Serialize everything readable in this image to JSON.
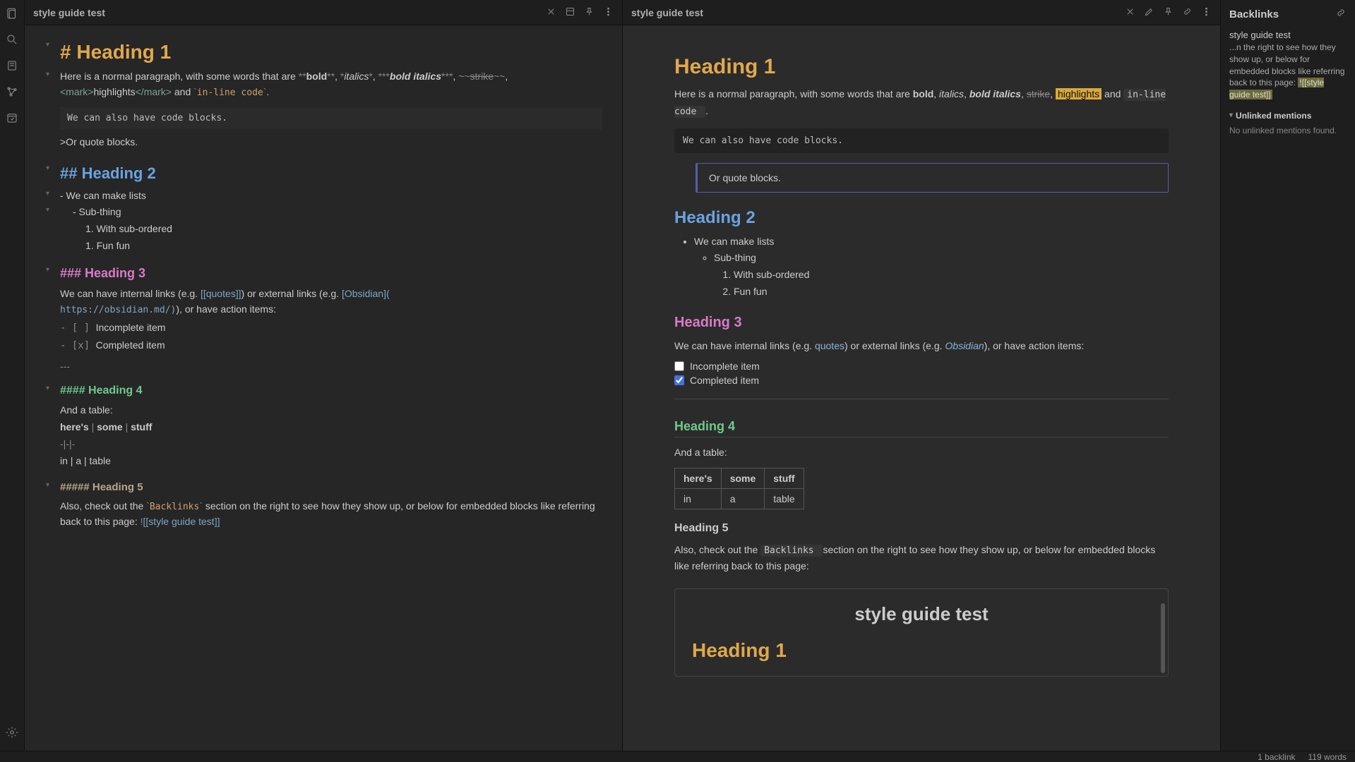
{
  "ribbon": {
    "icons": [
      "files",
      "search",
      "note",
      "graph",
      "daily",
      "settings"
    ]
  },
  "leftPane": {
    "title": "style guide test",
    "h1": "# Heading 1",
    "para1_a": "Here is a normal paragraph, with some words that are ",
    "bold_mk": "**",
    "bold": "bold",
    "ital_mk": "*",
    "ital": "italics",
    "bi_mk": "***",
    "bi": "bold italics",
    "strike_mk": "~~",
    "strike": "strike",
    "mark_open": "<mark>",
    "highlights": "highlights",
    "mark_close": "</mark>",
    "and": " and ",
    "tick": "`",
    "inline_code": "in-line code",
    "period": ".",
    "codeblk": "We can also have code blocks.",
    "quote": ">Or quote blocks.",
    "h2": "## Heading 2",
    "li1": "- We can make lists",
    "li2": "- Sub-thing",
    "li3": "1. With sub-ordered",
    "li4": "1. Fun fun",
    "h3": "### Heading 3",
    "p3_a": "We can have internal links (e.g. ",
    "lnk_q": "[[quotes]]",
    "p3_b": ") or external links (e.g. ",
    "lnk_o": "[Obsidian](",
    "lnk_u": "https://obsidian.md/)",
    "p3_c": "), or have action items:",
    "chk1_mk": "- [ ] ",
    "chk1": "Incomplete item",
    "chk2_mk": "- [x] ",
    "chk2": "Completed item",
    "hr": "---",
    "h4": "#### Heading 4",
    "tbl_intro": "And a table:",
    "tbl_h": "here's | some | stuff",
    "tbl_sep": "-|-|-",
    "tbl_r": "in | a | table",
    "thb": [
      "here's",
      "some",
      "stuff"
    ],
    "h5": "##### Heading 5",
    "p5_a": "Also, check out the ",
    "bl": "Backlinks",
    "p5_b": " section on the right to see how they show up, or below for embedded blocks like referring back to this page: ",
    "embed_mk": "!",
    "embed": "[[style guide test]]"
  },
  "rightPane": {
    "title": "style guide test",
    "h1": "Heading 1",
    "p1_a": "Here is a normal paragraph, with some words that are ",
    "bold": "bold",
    "ital": "italics",
    "bi": "bold italics",
    "strike": "strike",
    "hl": "highlights",
    "and": " and ",
    "inline": "in-line code ",
    "period": ".",
    "code": "We can also have code blocks.",
    "quote": "Or quote blocks.",
    "h2": "Heading 2",
    "li1": "We can make lists",
    "li2": "Sub-thing",
    "li3": "With sub-ordered",
    "li4": "Fun fun",
    "h3": "Heading 3",
    "p3_a": "We can have internal links (e.g. ",
    "lnk_q": "quotes",
    "p3_b": ") or external links (e.g. ",
    "lnk_o": "Obsidian",
    "p3_c": "), or have action items:",
    "chk1": "Incomplete item",
    "chk2": "Completed item",
    "h4": "Heading 4",
    "tbl_intro": "And a table:",
    "th": [
      "here's",
      "some",
      "stuff"
    ],
    "td": [
      "in",
      "a",
      "table"
    ],
    "h5": "Heading 5",
    "p5_a": "Also, check out the ",
    "bl": " Backlinks ",
    "p5_b": " section on the right to see how they show up, or below for embedded blocks like referring back to this page:",
    "embed_title": "style guide test",
    "embed_h1": "Heading 1"
  },
  "sidebar": {
    "title": "Backlinks",
    "link": "style guide test",
    "snip_a": "...n the right to see how they show up, or below for embedded blocks like referring back to this page: ",
    "snip_hl": "![[style guide test]]",
    "sec": "Unlinked mentions",
    "empty": "No unlinked mentions found."
  },
  "status": {
    "backlinks": "1 backlink",
    "words": "119 words"
  }
}
